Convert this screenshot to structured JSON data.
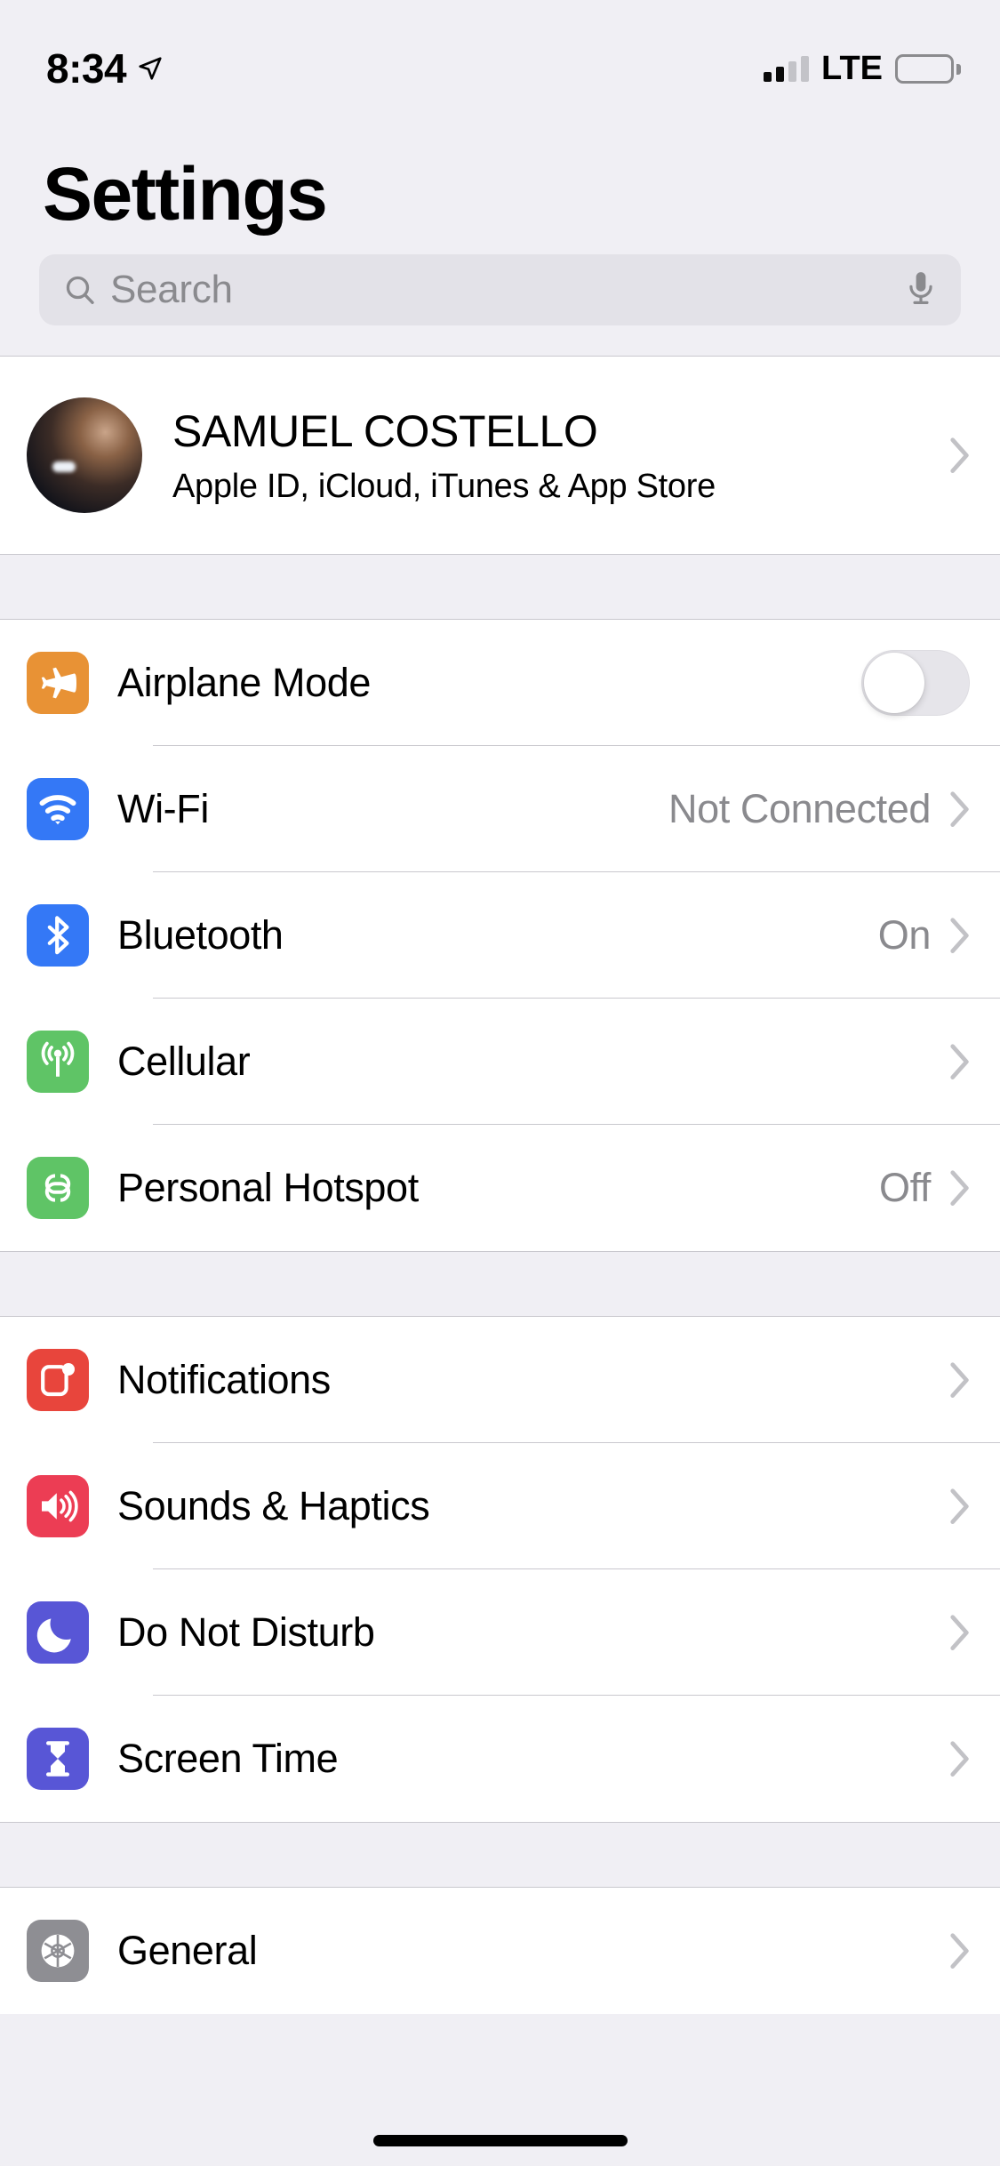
{
  "status_bar": {
    "time": "8:34",
    "location_icon": "location-arrow-icon",
    "signal_bars_filled": 2,
    "signal_bars_total": 4,
    "network": "LTE",
    "battery_icon": "battery-full-icon",
    "battery_level_percent": 100
  },
  "header": {
    "title": "Settings"
  },
  "search": {
    "placeholder": "Search",
    "value": "",
    "search_icon": "magnifier-icon",
    "mic_icon": "microphone-icon"
  },
  "profile": {
    "name": "SAMUEL COSTELLO",
    "subtitle": "Apple ID, iCloud, iTunes & App Store",
    "avatar_icon": "avatar",
    "chevron": "chevron-right-icon"
  },
  "groups": [
    {
      "id": "connectivity",
      "rows": [
        {
          "id": "airplane-mode",
          "label": "Airplane Mode",
          "icon": "airplane-icon",
          "icon_color": "#E89235",
          "control": "toggle",
          "toggle_on": false,
          "value": ""
        },
        {
          "id": "wifi",
          "label": "Wi-Fi",
          "icon": "wifi-icon",
          "icon_color": "#3478F6",
          "control": "chevron",
          "value": "Not Connected"
        },
        {
          "id": "bluetooth",
          "label": "Bluetooth",
          "icon": "bluetooth-icon",
          "icon_color": "#3478F6",
          "control": "chevron",
          "value": "On"
        },
        {
          "id": "cellular",
          "label": "Cellular",
          "icon": "cellular-antenna-icon",
          "icon_color": "#5FC466",
          "control": "chevron",
          "value": ""
        },
        {
          "id": "personal-hotspot",
          "label": "Personal Hotspot",
          "icon": "hotspot-link-icon",
          "icon_color": "#5FC466",
          "control": "chevron",
          "value": "Off"
        }
      ]
    },
    {
      "id": "alerts",
      "rows": [
        {
          "id": "notifications",
          "label": "Notifications",
          "icon": "notifications-icon",
          "icon_color": "#E8453C",
          "control": "chevron",
          "value": ""
        },
        {
          "id": "sounds-haptics",
          "label": "Sounds & Haptics",
          "icon": "speaker-icon",
          "icon_color": "#EC3D54",
          "control": "chevron",
          "value": ""
        },
        {
          "id": "do-not-disturb",
          "label": "Do Not Disturb",
          "icon": "moon-icon",
          "icon_color": "#5856D6",
          "control": "chevron",
          "value": ""
        },
        {
          "id": "screen-time",
          "label": "Screen Time",
          "icon": "hourglass-icon",
          "icon_color": "#5856D6",
          "control": "chevron",
          "value": ""
        }
      ]
    },
    {
      "id": "system",
      "rows": [
        {
          "id": "general",
          "label": "General",
          "icon": "gear-icon",
          "icon_color": "#8E8E93",
          "control": "chevron",
          "value": ""
        }
      ]
    }
  ],
  "home_indicator": "home-indicator-bar",
  "colors": {
    "page_background": "#F0EFF4",
    "row_background": "#FFFFFF",
    "separator": "#C9C8CE",
    "secondary_text": "#8A8A8E",
    "search_field": "#E3E2E8"
  }
}
